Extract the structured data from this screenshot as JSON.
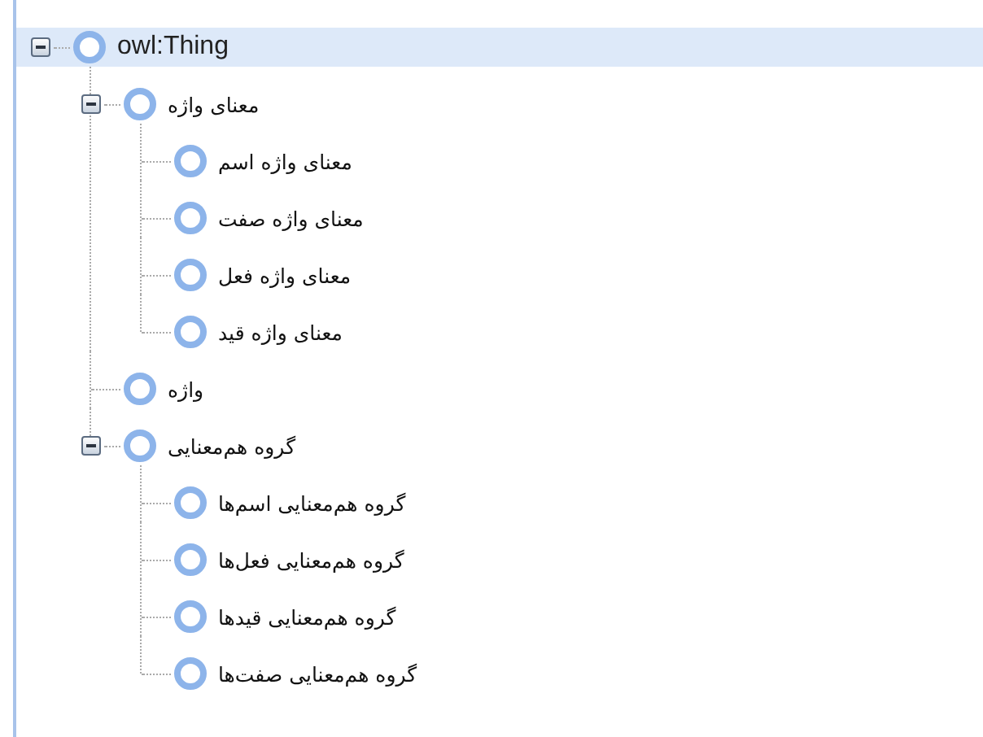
{
  "tree": [
    {
      "label": "owl:Thing",
      "selected": true,
      "expanded": true,
      "children": [
        {
          "label": "معنای واژه",
          "selected": false,
          "expanded": true,
          "children": [
            {
              "label": "معنای واژه اسم",
              "selected": false
            },
            {
              "label": "معنای واژه صفت",
              "selected": false
            },
            {
              "label": "معنای واژه فعل",
              "selected": false
            },
            {
              "label": "معنای واژه قید",
              "selected": false
            }
          ]
        },
        {
          "label": "واژه",
          "selected": false
        },
        {
          "label": "گروه هم‌معنایی",
          "selected": false,
          "expanded": true,
          "children": [
            {
              "label": "گروه هم‌معنایی اسم‌ها",
              "selected": false
            },
            {
              "label": "گروه هم‌معنایی فعل‌ها",
              "selected": false
            },
            {
              "label": "گروه هم‌معنایی قیدها",
              "selected": false
            },
            {
              "label": "گروه هم‌معنایی صفت‌ها",
              "selected": false
            }
          ]
        }
      ]
    }
  ]
}
